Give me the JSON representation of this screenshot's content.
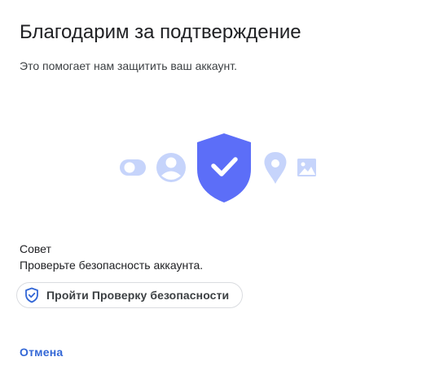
{
  "dialog": {
    "title": "Благодарим за подтверждение",
    "subtitle": "Это помогает нам защитить ваш аккаунт."
  },
  "illustration": {
    "icons": [
      "toggle-icon",
      "account-icon",
      "shield-check-icon",
      "location-pin-icon",
      "image-icon"
    ],
    "colors": {
      "shield": "#5c6ef8",
      "light_icons": "#c6d4fb"
    }
  },
  "tip": {
    "title": "Совет",
    "text": "Проверьте безопасность аккаунта."
  },
  "checkup_chip": {
    "icon": "shield-check-icon",
    "label": "Пройти Проверку безопасности"
  },
  "actions": {
    "cancel_label": "Отмена",
    "accent_color": "#3367d6"
  }
}
